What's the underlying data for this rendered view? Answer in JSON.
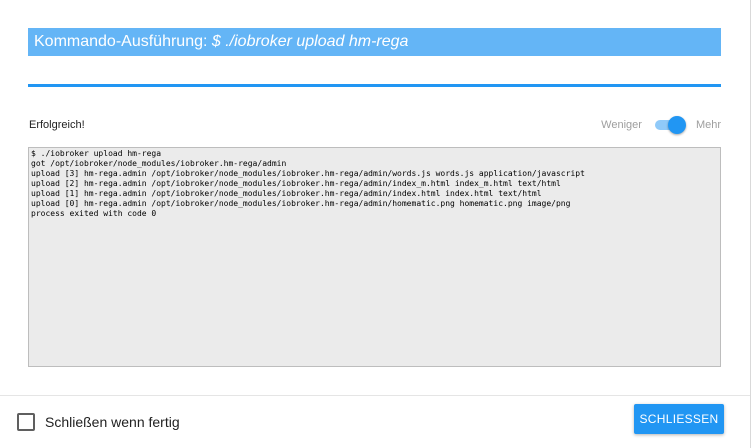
{
  "dialog": {
    "title_prefix": "Kommando-Ausführung: ",
    "title_command": "$ ./iobroker upload hm-rega",
    "status": "Erfolgreich!",
    "toggle": {
      "left_label": "Weniger",
      "right_label": "Mehr",
      "state": "on"
    },
    "output_lines": [
      "$ ./iobroker upload hm-rega",
      "got /opt/iobroker/node_modules/iobroker.hm-rega/admin",
      "upload [3] hm-rega.admin /opt/iobroker/node_modules/iobroker.hm-rega/admin/words.js words.js application/javascript",
      "upload [2] hm-rega.admin /opt/iobroker/node_modules/iobroker.hm-rega/admin/index_m.html index_m.html text/html",
      "upload [1] hm-rega.admin /opt/iobroker/node_modules/iobroker.hm-rega/admin/index.html index.html text/html",
      "upload [0] hm-rega.admin /opt/iobroker/node_modules/iobroker.hm-rega/admin/homematic.png homematic.png image/png",
      "process exited with code 0"
    ]
  },
  "footer": {
    "checkbox_label": "Schließen wenn fertig",
    "checkbox_checked": false,
    "close_button": "SCHLIESSEN"
  },
  "colors": {
    "accent": "#2196f3",
    "title_bar": "#64b5f6",
    "output_bg": "#ebebeb"
  }
}
